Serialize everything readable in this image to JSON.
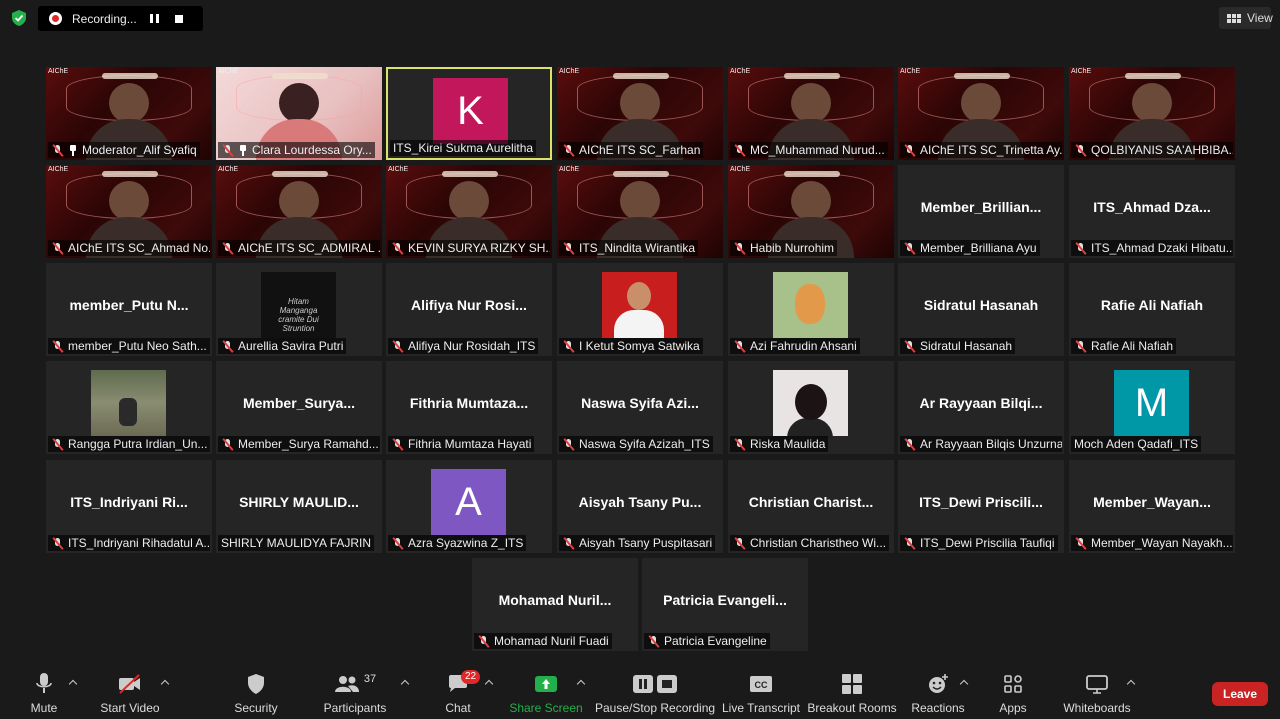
{
  "recording": {
    "label": "Recording..."
  },
  "view_label": "View",
  "participants": [
    {
      "name": "Moderator_Alif Syafiq",
      "big": "",
      "type": "video",
      "pinned": true
    },
    {
      "name": "Clara Lourdessa Ory...",
      "big": "",
      "type": "video-pink",
      "pinned": true
    },
    {
      "name": "ITS_Kirei Sukma Aurelitha",
      "big": "",
      "type": "avatar",
      "letter": "K",
      "color": "#c2185b",
      "speaker": true,
      "unmuted": true
    },
    {
      "name": "AIChE ITS SC_Farhan",
      "big": "",
      "type": "video"
    },
    {
      "name": "MC_Muhammad Nurud...",
      "big": "",
      "type": "video"
    },
    {
      "name": "AIChE ITS SC_Trinetta Ay...",
      "big": "",
      "type": "video"
    },
    {
      "name": "QOLBIYANIS SA'AHBIBA...",
      "big": "",
      "type": "video"
    },
    {
      "name": "AIChE ITS SC_Ahmad No...",
      "big": "",
      "type": "video"
    },
    {
      "name": "AIChE ITS SC_ADMIRAL ...",
      "big": "",
      "type": "video"
    },
    {
      "name": "KEVIN SURYA RIZKY SH...",
      "big": "",
      "type": "video"
    },
    {
      "name": "ITS_Nindita Wirantika",
      "big": "",
      "type": "video"
    },
    {
      "name": "Habib Nurrohim",
      "big": "",
      "type": "video"
    },
    {
      "name": "Member_Brilliana Ayu",
      "big": "Member_Brillian...",
      "type": "name"
    },
    {
      "name": "ITS_Ahmad Dzaki Hibatu...",
      "big": "ITS_Ahmad  Dza...",
      "type": "name"
    },
    {
      "name": "member_Putu Neo Sath...",
      "big": "member_Putu  N...",
      "type": "name"
    },
    {
      "name": "Aurellia Savira Putri",
      "big": "",
      "type": "photo-dark",
      "photo_text": "Hitam Manganga cramite Dui Struntion"
    },
    {
      "name": "Alifiya Nur Rosidah_ITS",
      "big": "Alifiya Nur Rosi...",
      "type": "name"
    },
    {
      "name": "I Ketut Somya Satwika",
      "big": "",
      "type": "photo-red"
    },
    {
      "name": "Azi Fahrudin Ahsani",
      "big": "",
      "type": "photo-giraffe"
    },
    {
      "name": "Sidratul Hasanah",
      "big": "Sidratul Hasanah",
      "type": "name"
    },
    {
      "name": "Rafie Ali Nafiah",
      "big": "Rafie Ali Nafiah",
      "type": "name"
    },
    {
      "name": "Rangga Putra Irdian_Un...",
      "big": "",
      "type": "photo-nature"
    },
    {
      "name": "Member_Surya Ramahd...",
      "big": "Member_Surya...",
      "type": "name"
    },
    {
      "name": "Fithria Mumtaza Hayati",
      "big": "Fithria  Mumtaza...",
      "type": "name"
    },
    {
      "name": "Naswa Syifa Azizah_ITS",
      "big": "Naswa Syifa Azi...",
      "type": "name"
    },
    {
      "name": "Riska Maulida",
      "big": "",
      "type": "photo-girl"
    },
    {
      "name": "Ar Rayyaan Bilqis Unzurna",
      "big": "Ar Rayyaan Bilqi...",
      "type": "name"
    },
    {
      "name": "Moch Aden Qadafi_ITS",
      "big": "",
      "type": "avatar",
      "letter": "M",
      "color": "#0097a7",
      "unmuted": true
    },
    {
      "name": "ITS_Indriyani Rihadatul A...",
      "big": "ITS_Indriyani  Ri...",
      "type": "name"
    },
    {
      "name": "SHIRLY MAULIDYA FAJRIN",
      "big": "SHIRLY  MAULID...",
      "type": "name",
      "unmuted": true
    },
    {
      "name": "Azra Syazwina Z_ITS",
      "big": "",
      "type": "avatar",
      "letter": "A",
      "color": "#7e57c2"
    },
    {
      "name": "Aisyah Tsany Puspitasari",
      "big": "Aisyah  Tsany  Pu...",
      "type": "name"
    },
    {
      "name": "Christian Charistheo Wi...",
      "big": "Christian  Charist...",
      "type": "name"
    },
    {
      "name": "ITS_Dewi Priscilia Taufiqi",
      "big": "ITS_Dewi  Priscili...",
      "type": "name"
    },
    {
      "name": "Member_Wayan Nayakh...",
      "big": "Member_Wayan...",
      "type": "name"
    },
    {
      "name": "Mohamad Nuril Fuadi",
      "big": "Mohamad  Nuril...",
      "type": "name"
    },
    {
      "name": "Patricia Evangeline",
      "big": "Patricia  Evangeli...",
      "type": "name"
    }
  ],
  "toolbar": {
    "mute": "Mute",
    "start_video": "Start Video",
    "security": "Security",
    "participants": "Participants",
    "participants_count": "37",
    "chat": "Chat",
    "chat_badge": "22",
    "share_screen": "Share Screen",
    "recording": "Pause/Stop Recording",
    "live_transcript": "Live Transcript",
    "breakout": "Breakout Rooms",
    "reactions": "Reactions",
    "apps": "Apps",
    "whiteboards": "Whiteboards",
    "leave": "Leave"
  },
  "colors": {
    "accent_green": "#23b04a",
    "leave_red": "#c92323",
    "speaker_border": "#d9e36a"
  }
}
